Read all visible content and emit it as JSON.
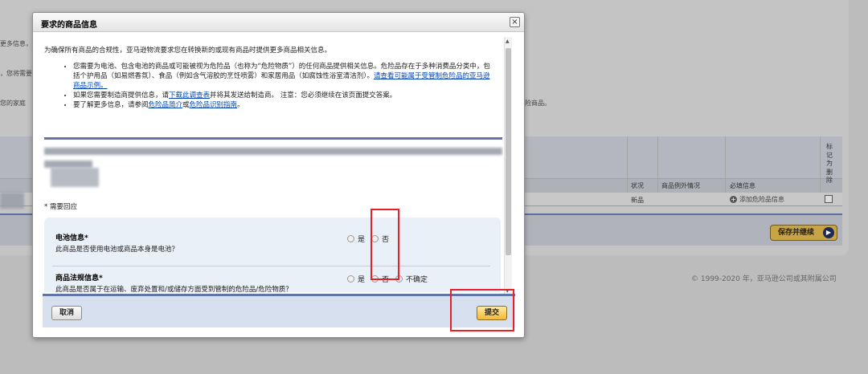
{
  "background": {
    "frag_1": "更多信息，",
    "frag_2": "，您将需要",
    "frag_3": "您的家庭",
    "frag_4": "险商品。",
    "col_status": "状况",
    "col_exception": "商品例外情况",
    "col_required": "必填信息",
    "col_mark": "标记为删除",
    "row_status": "新品",
    "row_action": "添加危险品信息",
    "save_button": "保存并继续",
    "copyright": "© 1999-2020 年，亚马逊公司或其附属公司"
  },
  "modal": {
    "title": "要求的商品信息",
    "intro": "为确保所有商品的合规性，亚马逊物流要求您在转换新的或现有商品时提供更多商品相关信息。",
    "bullet_1_text": "您需要为电池、包含电池的商品或可能被视为危险品（也称为“危险物质”）的任何商品提供相关信息。危险品存在于多种消费品分类中，包括个护用品（如易燃香氛）、食品（例如含气溶胶的烹饪喷雾）和家居用品（如腐蚀性浴室清洁剂）。",
    "bullet_1_link": "请查看可能属于受管制危险品的亚马逊商品示例。",
    "bullet_2_pre": "如果您需要制造商提供信息，请",
    "bullet_2_link": "下载此调查表",
    "bullet_2_post": "并将其发送给制造商。 注意：您必须继续在该页面提交答案。",
    "bullet_3_pre": "要了解更多信息，请参阅",
    "bullet_3_link1": "危险品简介",
    "bullet_3_mid": "或",
    "bullet_3_link2": "危险品识别指南",
    "bullet_3_post": "。",
    "required_note": "* 需要回应",
    "questions": [
      {
        "title": "电池信息*",
        "desc": "此商品是否使用电池或商品本身是电池？",
        "options": [
          "是",
          "否"
        ]
      },
      {
        "title": "商品法规信息*",
        "desc": "此商品是否属于在运输、废弃处置和/或储存方面受到管制的危险品/危险物质？",
        "options": [
          "是",
          "否",
          "不确定"
        ]
      }
    ],
    "cancel_label": "取消",
    "submit_label": "提交",
    "close_label": "×"
  },
  "colors": {
    "accent_blue": "#6176a8",
    "highlight_red": "#e8202a",
    "submit_gold": "#f3b934"
  }
}
